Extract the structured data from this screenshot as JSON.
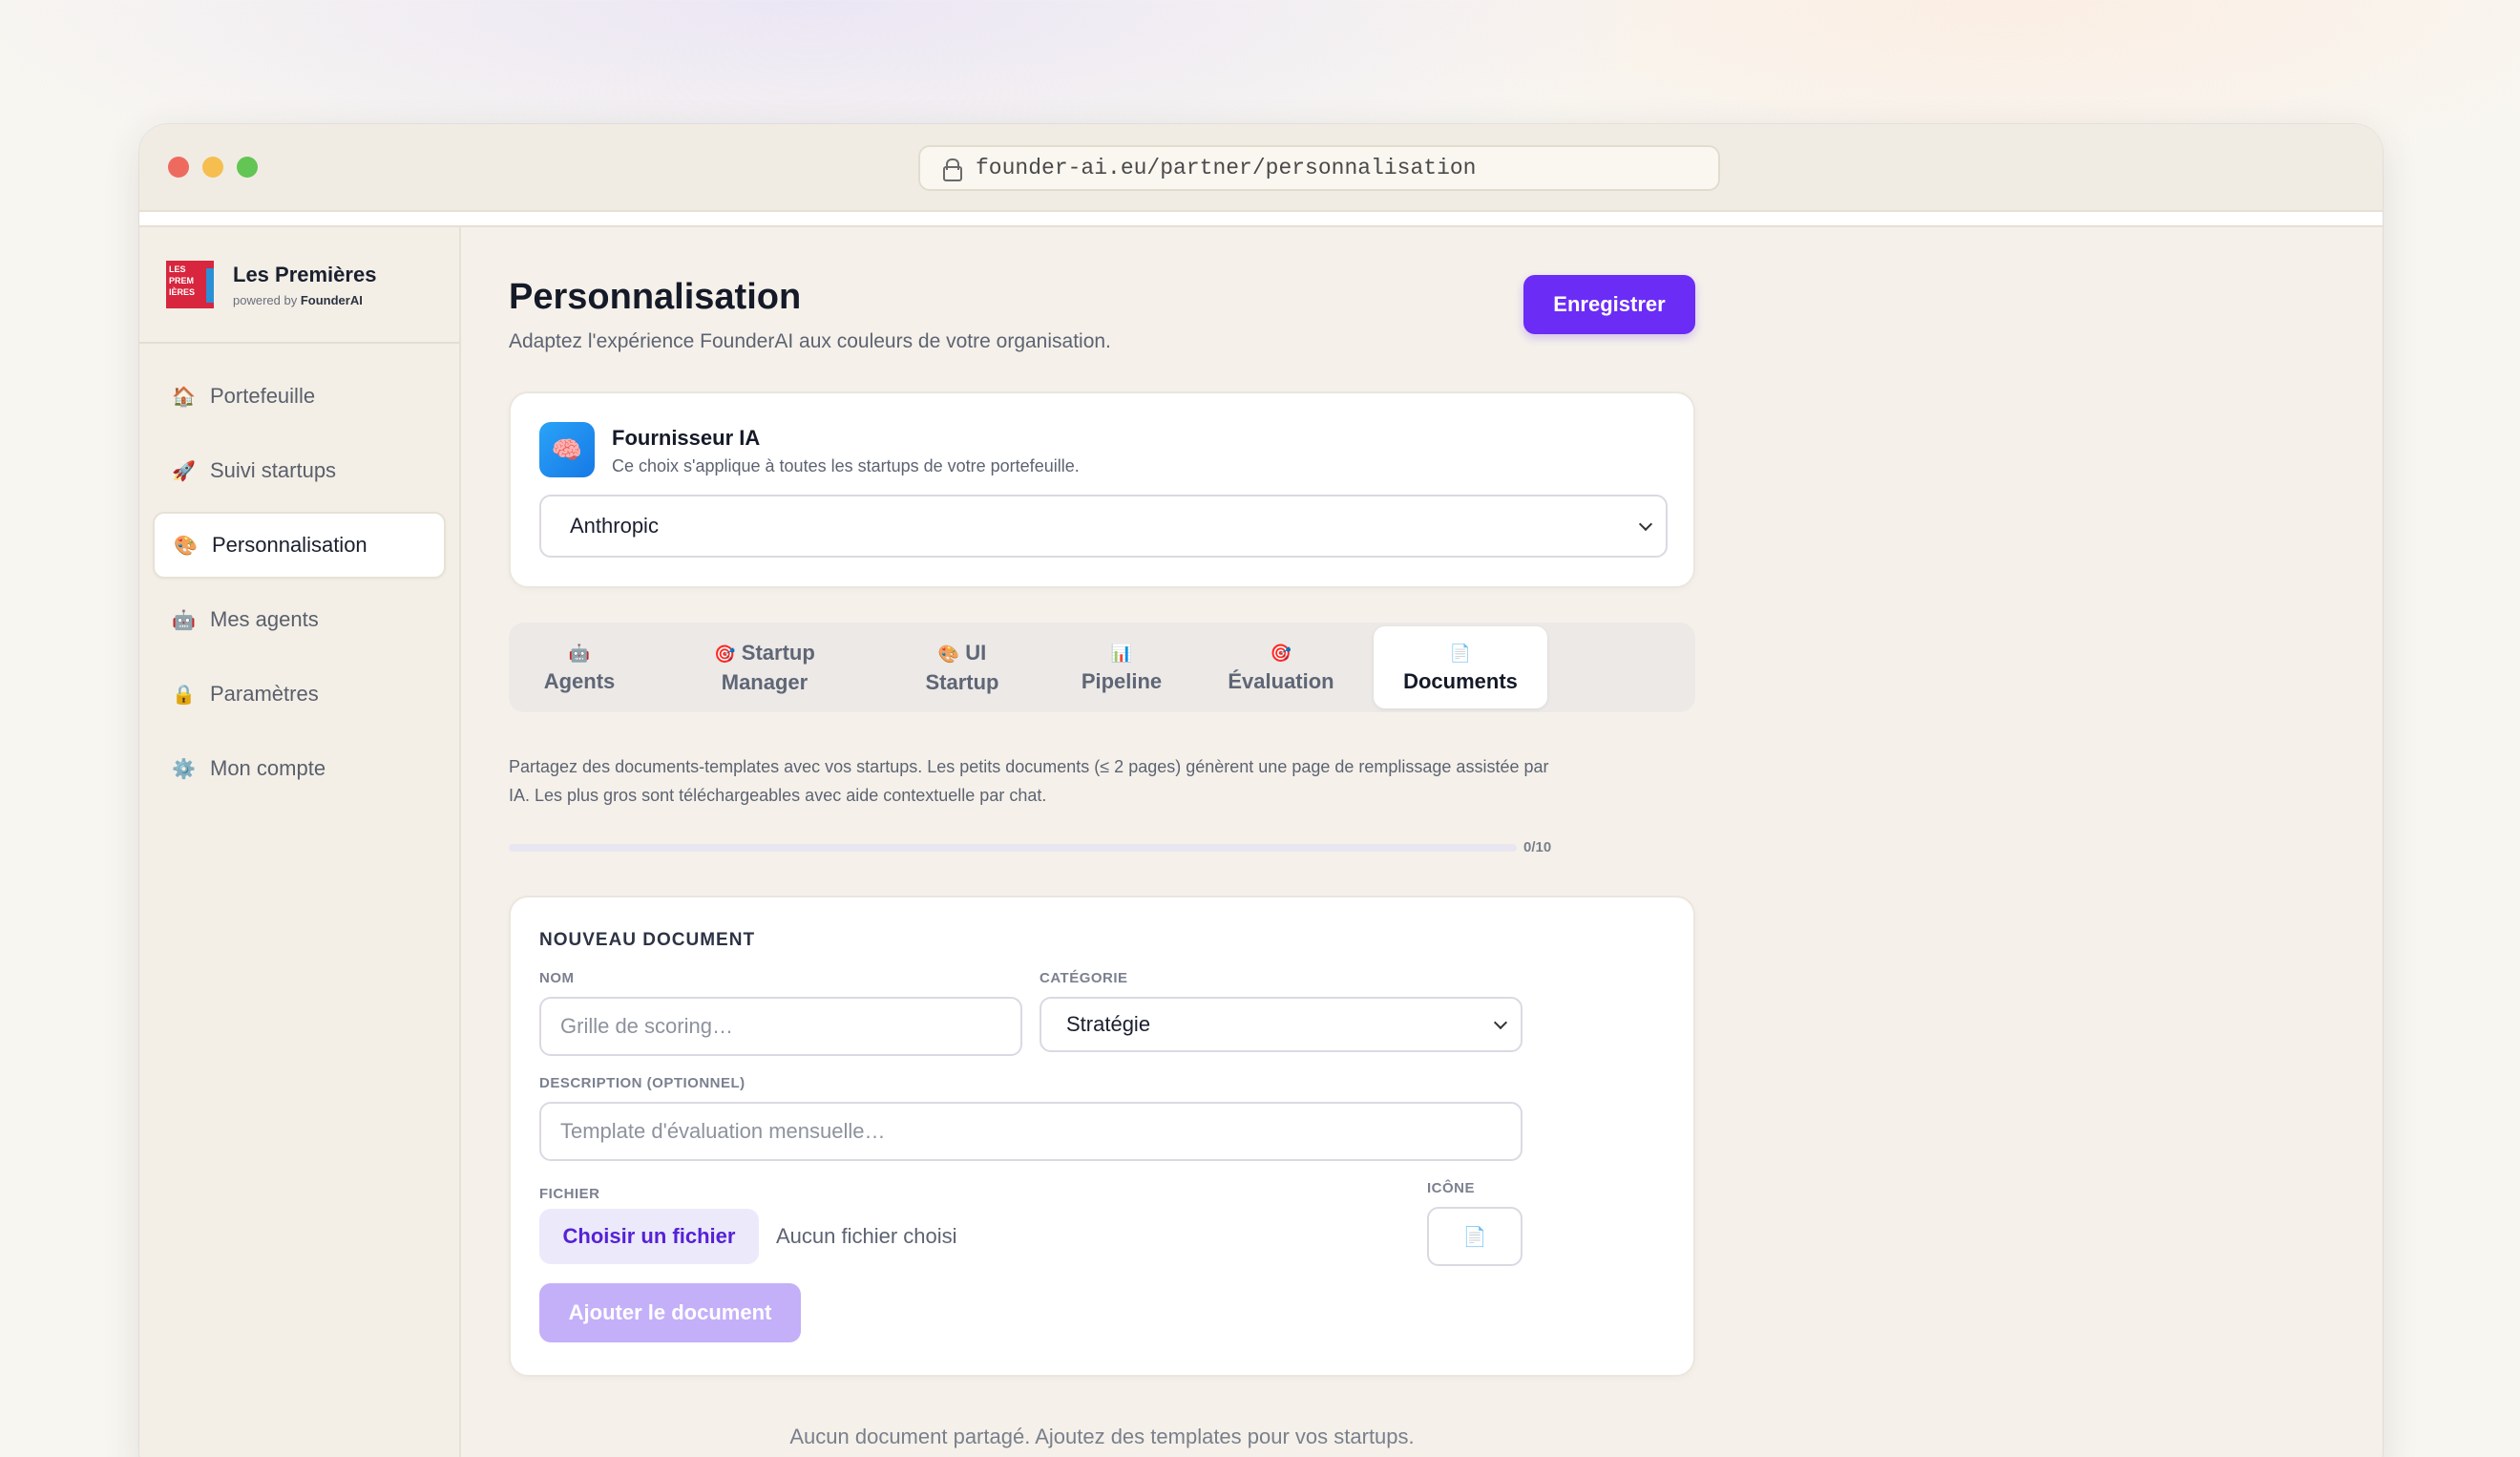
{
  "browser": {
    "url": "founder-ai.eu/partner/personnalisation"
  },
  "brand": {
    "logo_text": [
      "LES",
      "PREM",
      "IÈRES"
    ],
    "name": "Les Premières",
    "powered_prefix": "powered by ",
    "powered_name": "FounderAI",
    "logo_color": "#d7263d"
  },
  "sidebar": {
    "items": [
      {
        "label": "Portefeuille",
        "icon": "🏠",
        "icon_name": "house-icon"
      },
      {
        "label": "Suivi startups",
        "icon": "🚀",
        "icon_name": "rocket-icon"
      },
      {
        "label": "Personnalisation",
        "icon": "🎨",
        "icon_name": "palette-icon",
        "active": true
      },
      {
        "label": "Mes agents",
        "icon": "🤖",
        "icon_name": "robot-icon"
      },
      {
        "label": "Paramètres",
        "icon": "🔒",
        "icon_name": "lock-icon"
      },
      {
        "label": "Mon compte",
        "icon": "⚙️",
        "icon_name": "gear-icon"
      }
    ]
  },
  "header": {
    "title": "Personnalisation",
    "subtitle": "Adaptez l'expérience FounderAI aux couleurs de votre organisation.",
    "save_label": "Enregistrer",
    "accent": "#6b2cf5"
  },
  "provider": {
    "icon": "🧠",
    "icon_name": "brain-icon",
    "title": "Fournisseur IA",
    "subtitle": "Ce choix s'applique à toutes les startups de votre portefeuille.",
    "selected": "Anthropic"
  },
  "tabs": [
    {
      "icon": "🤖",
      "icon_name": "robot-icon",
      "label1": "Agents",
      "label2": ""
    },
    {
      "icon": "🎯",
      "icon_name": "target-icon",
      "label1": "Startup",
      "label2": "Manager"
    },
    {
      "icon": "🎨",
      "icon_name": "palette-icon",
      "label1": "UI",
      "label2": "Startup"
    },
    {
      "icon": "📊",
      "icon_name": "chart-icon",
      "label1": "Pipeline",
      "label2": ""
    },
    {
      "icon": "🎯",
      "icon_name": "target-icon",
      "label1": "Évaluation",
      "label2": ""
    },
    {
      "icon": "📄",
      "icon_name": "document-icon",
      "label1": "Documents",
      "label2": "",
      "active": true
    }
  ],
  "documents": {
    "info": "Partagez des documents-templates avec vos startups. Les petits documents (≤ 2 pages) génèrent une page de remplissage assistée par IA. Les plus gros sont téléchargeables avec aide contextuelle par chat.",
    "progress_value": 0,
    "progress_max": 10,
    "progress_label": "0/10",
    "empty_message": "Aucun document partagé. Ajoutez des templates pour vos startups."
  },
  "new_doc": {
    "title": "NOUVEAU DOCUMENT",
    "name_label": "NOM",
    "name_placeholder": "Grille de scoring…",
    "category_label": "CATÉGORIE",
    "category_selected": "Stratégie",
    "description_label": "DESCRIPTION (OPTIONNEL)",
    "description_placeholder": "Template d'évaluation mensuelle…",
    "file_label": "FICHIER",
    "file_button": "Choisir un fichier",
    "file_none": "Aucun fichier choisi",
    "icon_label": "ICÔNE",
    "icon_value": "📄",
    "add_button": "Ajouter le document"
  }
}
